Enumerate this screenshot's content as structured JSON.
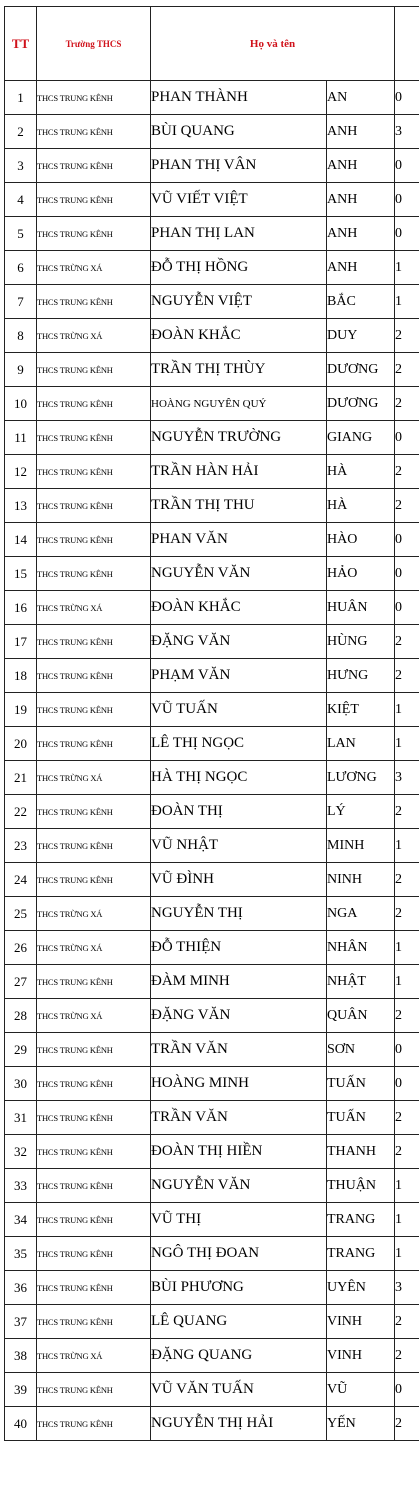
{
  "table": {
    "headers": {
      "tt": "TT",
      "school": "Trường THCS",
      "name": "Họ và tên"
    },
    "rows": [
      {
        "tt": "1",
        "school": "THCS TRUNG KÊNH",
        "ho": "PHAN THÀNH",
        "ten": "AN",
        "extra": "0"
      },
      {
        "tt": "2",
        "school": "THCS TRUNG KÊNH",
        "ho": "BÙI QUANG",
        "ten": "ANH",
        "extra": "3"
      },
      {
        "tt": "3",
        "school": "THCS TRUNG KÊNH",
        "ho": "PHAN THỊ VÂN",
        "ten": "ANH",
        "extra": "0"
      },
      {
        "tt": "4",
        "school": "THCS TRUNG KÊNH",
        "ho": "VŨ VIẾT VIỆT",
        "ten": "ANH",
        "extra": "0"
      },
      {
        "tt": "5",
        "school": "THCS TRUNG KÊNH",
        "ho": "PHAN THỊ LAN",
        "ten": "ANH",
        "extra": "0"
      },
      {
        "tt": "6",
        "school": "THCS TRỪNG XÁ",
        "ho": "ĐỖ THỊ HỒNG",
        "ten": "ANH",
        "extra": "1"
      },
      {
        "tt": "7",
        "school": "THCS TRUNG KÊNH",
        "ho": "NGUYỄN VIỆT",
        "ten": "BẮC",
        "extra": "1"
      },
      {
        "tt": "8",
        "school": "THCS TRỪNG XÁ",
        "ho": "ĐOÀN KHẮC",
        "ten": "DUY",
        "extra": "2"
      },
      {
        "tt": "9",
        "school": "THCS TRUNG KÊNH",
        "ho": "TRẦN THỊ THÙY",
        "ten": "DƯƠNG",
        "extra": "2"
      },
      {
        "tt": "10",
        "school": "THCS TRUNG KÊNH",
        "ho": "HOÀNG NGUYÊN QUÝ",
        "ten": "DƯƠNG",
        "extra": "2"
      },
      {
        "tt": "11",
        "school": "THCS TRUNG KÊNH",
        "ho": "NGUYỄN TRƯỜNG",
        "ten": "GIANG",
        "extra": "0"
      },
      {
        "tt": "12",
        "school": "THCS TRUNG KÊNH",
        "ho": "TRẦN HÀN HẢI",
        "ten": "HÀ",
        "extra": "2"
      },
      {
        "tt": "13",
        "school": "THCS TRUNG KÊNH",
        "ho": "TRẦN THỊ THU",
        "ten": "HÀ",
        "extra": "2"
      },
      {
        "tt": "14",
        "school": "THCS TRUNG KÊNH",
        "ho": "PHAN VĂN",
        "ten": "HÀO",
        "extra": "0"
      },
      {
        "tt": "15",
        "school": "THCS TRUNG KÊNH",
        "ho": "NGUYỄN VĂN",
        "ten": "HẢO",
        "extra": "0"
      },
      {
        "tt": "16",
        "school": "THCS TRỪNG XÁ",
        "ho": "ĐOÀN KHẮC",
        "ten": "HUÂN",
        "extra": "0"
      },
      {
        "tt": "17",
        "school": "THCS TRUNG KÊNH",
        "ho": "ĐẶNG VĂN",
        "ten": "HÙNG",
        "extra": "2"
      },
      {
        "tt": "18",
        "school": "THCS TRUNG KÊNH",
        "ho": "PHẠM VĂN",
        "ten": "HƯNG",
        "extra": "2"
      },
      {
        "tt": "19",
        "school": "THCS TRUNG KÊNH",
        "ho": "VŨ TUẤN",
        "ten": "KIỆT",
        "extra": "1"
      },
      {
        "tt": "20",
        "school": "THCS TRUNG KÊNH",
        "ho": "LÊ THỊ NGỌC",
        "ten": "LAN",
        "extra": "1"
      },
      {
        "tt": "21",
        "school": "THCS TRỪNG XÁ",
        "ho": "HÀ THỊ NGỌC",
        "ten": "LƯƠNG",
        "extra": "3"
      },
      {
        "tt": "22",
        "school": "THCS TRUNG KÊNH",
        "ho": "ĐOÀN THỊ",
        "ten": "LÝ",
        "extra": "2"
      },
      {
        "tt": "23",
        "school": "THCS TRUNG KÊNH",
        "ho": "VŨ NHẬT",
        "ten": "MINH",
        "extra": "1"
      },
      {
        "tt": "24",
        "school": "THCS TRUNG KÊNH",
        "ho": "VŨ ĐÌNH",
        "ten": "NINH",
        "extra": "2"
      },
      {
        "tt": "25",
        "school": "THCS TRỪNG XÁ",
        "ho": "NGUYỄN THỊ",
        "ten": "NGA",
        "extra": "2"
      },
      {
        "tt": "26",
        "school": "THCS TRỪNG XÁ",
        "ho": "ĐỖ THIỆN",
        "ten": "NHÂN",
        "extra": "1"
      },
      {
        "tt": "27",
        "school": "THCS TRUNG KÊNH",
        "ho": "ĐÀM MINH",
        "ten": "NHẬT",
        "extra": "1"
      },
      {
        "tt": "28",
        "school": "THCS TRỪNG XÁ",
        "ho": "ĐẶNG VĂN",
        "ten": "QUÂN",
        "extra": "2"
      },
      {
        "tt": "29",
        "school": "THCS TRUNG KÊNH",
        "ho": "TRẦN VĂN",
        "ten": "SƠN",
        "extra": "0"
      },
      {
        "tt": "30",
        "school": "THCS TRUNG KÊNH",
        "ho": "HOÀNG MINH",
        "ten": "TUẤN",
        "extra": "0"
      },
      {
        "tt": "31",
        "school": "THCS TRUNG KÊNH",
        "ho": "TRẦN VĂN",
        "ten": "TUẤN",
        "extra": "2"
      },
      {
        "tt": "32",
        "school": "THCS TRUNG KÊNH",
        "ho": "ĐOÀN THỊ HIỀN",
        "ten": "THANH",
        "extra": "2"
      },
      {
        "tt": "33",
        "school": "THCS TRUNG KÊNH",
        "ho": "NGUYỄN VĂN",
        "ten": "THUẬN",
        "extra": "1"
      },
      {
        "tt": "34",
        "school": "THCS TRUNG KÊNH",
        "ho": "VŨ THỊ",
        "ten": "TRANG",
        "extra": "1"
      },
      {
        "tt": "35",
        "school": "THCS TRUNG KÊNH",
        "ho": "NGÔ THỊ ĐOAN",
        "ten": "TRANG",
        "extra": "1"
      },
      {
        "tt": "36",
        "school": "THCS TRUNG KÊNH",
        "ho": "BÙI PHƯƠNG",
        "ten": "UYÊN",
        "extra": "3"
      },
      {
        "tt": "37",
        "school": "THCS TRUNG KÊNH",
        "ho": "LÊ QUANG",
        "ten": "VINH",
        "extra": "2"
      },
      {
        "tt": "38",
        "school": "THCS TRỪNG XÁ",
        "ho": "ĐẶNG QUANG",
        "ten": "VINH",
        "extra": "2"
      },
      {
        "tt": "39",
        "school": "THCS TRUNG KÊNH",
        "ho": "VŨ VĂN TUẤN",
        "ten": "VŨ",
        "extra": "0"
      },
      {
        "tt": "40",
        "school": "THCS TRUNG KÊNH",
        "ho": "NGUYỄN THỊ HẢI",
        "ten": "YẾN",
        "extra": "2"
      }
    ]
  }
}
